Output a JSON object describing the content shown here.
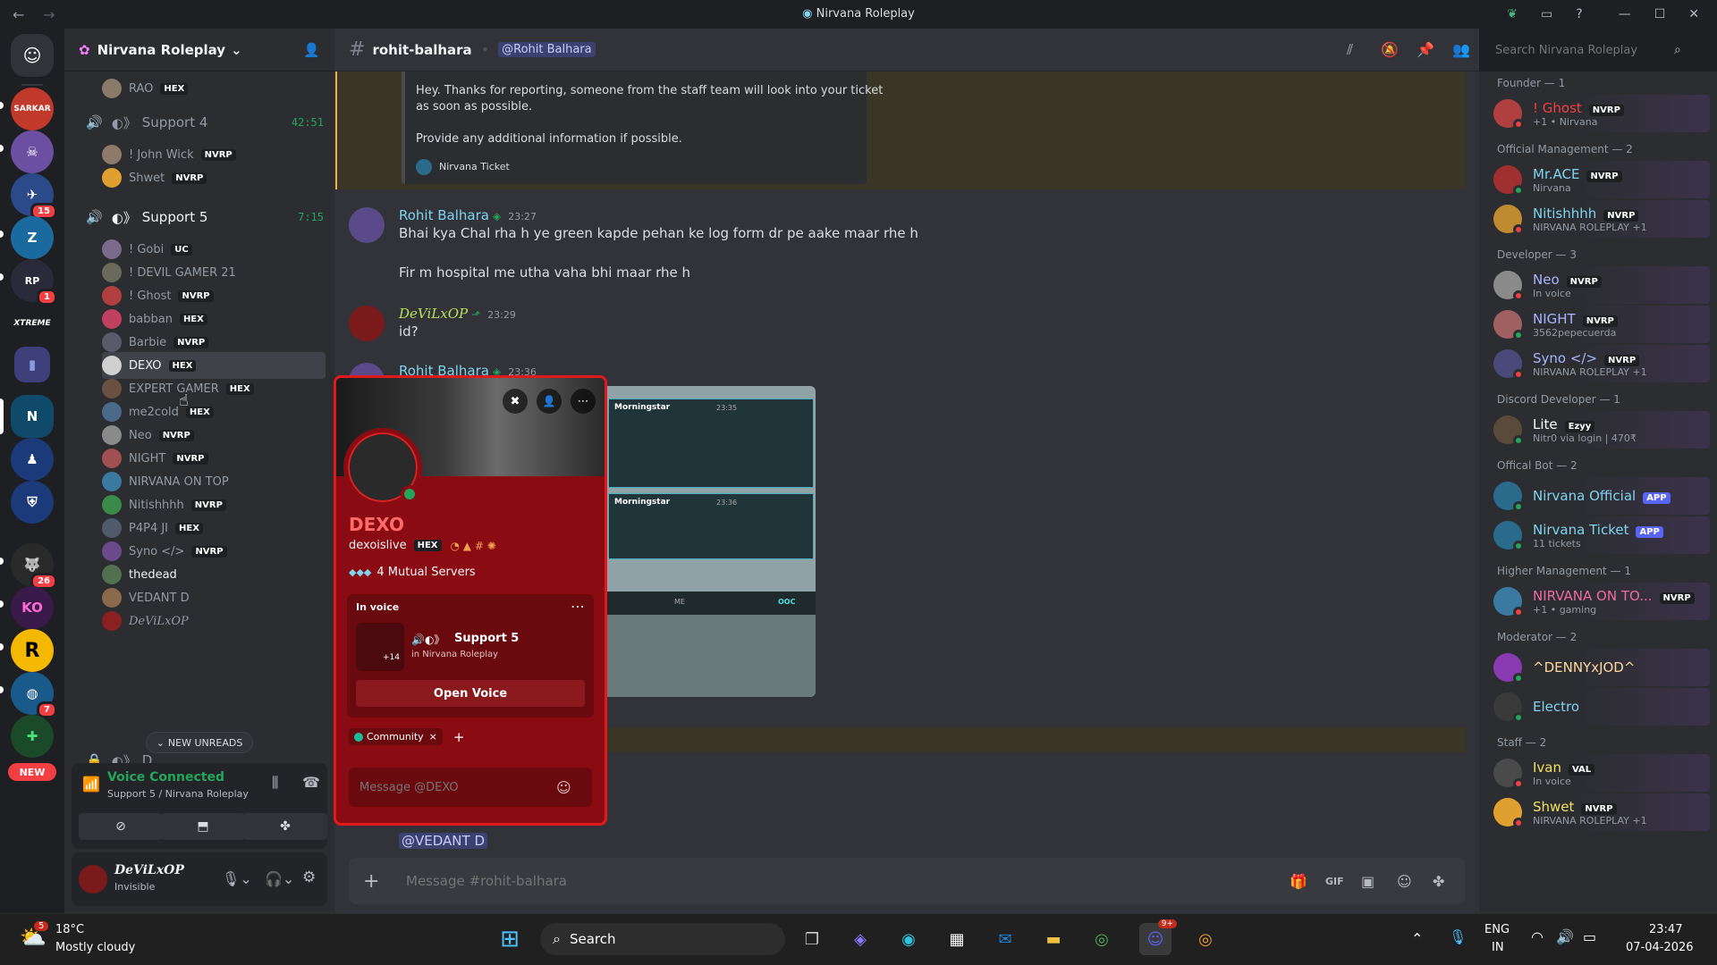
{
  "window": {
    "title": "Nirvana Roleplay"
  },
  "servers": {
    "badges": [
      "15",
      "1",
      "26",
      "7"
    ],
    "new_label": "NEW",
    "xtreme": "XTREME",
    "sarkar": "SARKAR"
  },
  "sidebar": {
    "server_name": "Nirvana Roleplay",
    "top_user": {
      "name": "RAO",
      "tag": "HEX"
    },
    "channels": [
      {
        "name": "Support 4",
        "time": "42:51",
        "users": [
          {
            "name": "! John Wick",
            "tag": "NVRP",
            "color": "#8e7a6a"
          },
          {
            "name": "Shwet",
            "tag": "NVRP",
            "color": "#e0a030"
          }
        ]
      },
      {
        "name": "Support 5",
        "time": "7:15",
        "users": [
          {
            "name": "! Gobi",
            "tag": "UC",
            "color": "#7a6b8a"
          },
          {
            "name": "! DEVIL GAMER 21",
            "tag": "",
            "color": "#6a6a5a"
          },
          {
            "name": "! Ghost",
            "tag": "NVRP",
            "color": "#b04040"
          },
          {
            "name": "babban",
            "tag": "HEX",
            "color": "#c04060"
          },
          {
            "name": "Barbie",
            "tag": "NVRP",
            "color": "#5a5a6a"
          },
          {
            "name": "DEXO",
            "tag": "HEX",
            "color": "#d0d0d0"
          },
          {
            "name": "EXPERT GAMER",
            "tag": "HEX",
            "color": "#6a5040"
          },
          {
            "name": "me2cold",
            "tag": "HEX",
            "color": "#4a6a8a"
          },
          {
            "name": "Neo",
            "tag": "NVRP",
            "color": "#8a8a8a"
          },
          {
            "name": "NIGHT",
            "tag": "NVRP",
            "color": "#a05050"
          },
          {
            "name": "NIRVANA ON TOP",
            "tag": "",
            "color": "#3a7aa0"
          },
          {
            "name": "Nitishhhh",
            "tag": "NVRP",
            "color": "#3a8a4a"
          },
          {
            "name": "P4P4 JI",
            "tag": "HEX",
            "color": "#505a6a"
          },
          {
            "name": "Syno </>",
            "tag": "NVRP",
            "color": "#6a4a8a"
          },
          {
            "name": "thedead",
            "tag": "",
            "color": "#507050"
          },
          {
            "name": "VEDANT D",
            "tag": "",
            "color": "#8a6a4a"
          },
          {
            "name": "DeViLxOP",
            "tag": "",
            "color": "#8a2020"
          }
        ]
      }
    ],
    "locked_channel": "D",
    "new_unreads": "NEW UNREADS",
    "voice": {
      "status": "Voice Connected",
      "location": "Support 5 / Nirvana Roleplay"
    },
    "user": {
      "name": "DeViLxOP",
      "status": "Invisible"
    }
  },
  "channel": {
    "name": "rohit-balhara",
    "mention": "@Rohit Balhara",
    "search_placeholder": "Search Nirvana Roleplay"
  },
  "messages": {
    "embed_line1": "Hey. Thanks for reporting, someone from the staff team will look into your ticket",
    "embed_line2": "as soon as possible.",
    "embed_line3": "Provide any additional information if possible.",
    "embed_footer": "Nirvana Ticket",
    "m1_author": "Rohit Balhara",
    "m1_time": "23:27",
    "m1_line1": "Bhai kya Chal rha h ye green kapde pehan ke log form dr pe aake maar rhe h",
    "m1_line2": "Fir m hospital me utha vaha bhi maar rhe h",
    "m2_author": "DeViLxOP",
    "m2_time": "23:29",
    "m2_text": "id?",
    "m3_author": "Rohit Balhara",
    "m3_time": "23:36",
    "img_label1": "Morningstar",
    "img_time1": "23:35",
    "img_label2": "Morningstar",
    "img_time2": "23:36",
    "img_me": "ME",
    "img_ooc": "OOC",
    "mention_vedant": "@VEDANT D",
    "input_placeholder": "Message #rohit-balhara"
  },
  "popup": {
    "display_name": "DEXO",
    "username": "dexoislive",
    "tag": "HEX",
    "mutual": "4 Mutual Servers",
    "in_voice": "In voice",
    "voice_channel": "Support 5",
    "voice_server": "in Nirvana Roleplay",
    "more_count": "+14",
    "open_voice": "Open Voice",
    "community": "Community",
    "message_placeholder": "Message @DEXO"
  },
  "members": {
    "groups": [
      {
        "label": "Founder — 1",
        "members": [
          {
            "name": "! Ghost",
            "tag": "NVRP",
            "sub": "+1 • Nirvana",
            "color": "#f23f43",
            "av": "#b04040",
            "status": "#f23f43"
          }
        ]
      },
      {
        "label": "Official Management — 2",
        "members": [
          {
            "name": "Mr.ACE",
            "tag": "NVRP",
            "sub": "Nirvana",
            "color": "#7fd4f0",
            "av": "#a03030",
            "status": "#23a55a"
          },
          {
            "name": "Nitishhhh",
            "tag": "NVRP",
            "sub": "NIRVANA ROLEPLAY +1",
            "color": "#7fd4f0",
            "av": "#c08a30",
            "status": "#f23f43"
          }
        ]
      },
      {
        "label": "Developer — 3",
        "members": [
          {
            "name": "Neo",
            "tag": "NVRP",
            "sub": "In voice",
            "color": "#a9b4ff",
            "av": "#8a8a8a",
            "status": "#f23f43"
          },
          {
            "name": "NIGHT",
            "tag": "NVRP",
            "sub": "3562pepecuerda",
            "color": "#a9b4ff",
            "av": "#a06060",
            "status": "#23a55a"
          },
          {
            "name": "Syno </>",
            "tag": "NVRP",
            "sub": "NIRVANA ROLEPLAY +1",
            "color": "#a9b4ff",
            "av": "#4a4a7a",
            "status": "#f23f43"
          }
        ]
      },
      {
        "label": "Discord Developer — 1",
        "members": [
          {
            "name": "Lite",
            "tag": "Ezyy",
            "sub": "Nitr0 via login | 470₹",
            "color": "#ffffff",
            "av": "#5a4a3a",
            "status": "#23a55a"
          }
        ]
      },
      {
        "label": "Offical Bot — 2",
        "members": [
          {
            "name": "Nirvana Official",
            "tag": "APP",
            "sub": "",
            "color": "#7fd4f0",
            "av": "#2a6a8a",
            "status": "#23a55a"
          },
          {
            "name": "Nirvana Ticket",
            "tag": "APP",
            "sub": "11 tickets",
            "color": "#7fd4f0",
            "av": "#2a6a8a",
            "status": "#23a55a"
          }
        ]
      },
      {
        "label": "Higher Management — 1",
        "members": [
          {
            "name": "NIRVANA ON TO...",
            "tag": "NVRP",
            "sub": "+1 • gaming",
            "color": "#f06aa0",
            "av": "#3a7aa0",
            "status": "#f23f43"
          }
        ]
      },
      {
        "label": "Moderator — 2",
        "members": [
          {
            "name": "^DENNYxJOD^",
            "tag": "",
            "sub": "",
            "color": "#ffd7a0",
            "av": "#8a3ab0",
            "status": "#23a55a"
          },
          {
            "name": "Electro",
            "tag": "",
            "sub": "",
            "color": "#7fd4f0",
            "av": "#3a3a3a",
            "status": "#23a55a"
          }
        ]
      },
      {
        "label": "Staff — 2",
        "members": [
          {
            "name": "Ivan",
            "tag": "VAL",
            "sub": "In voice",
            "color": "#f0e060",
            "av": "#4a4a4a",
            "status": "#f23f43"
          },
          {
            "name": "Shwet",
            "tag": "NVRP",
            "sub": "NIRVANA ROLEPLAY +1",
            "color": "#f0e060",
            "av": "#e0a030",
            "status": "#f23f43"
          }
        ]
      }
    ]
  },
  "taskbar": {
    "weather_temp": "18°C",
    "weather_desc": "Mostly cloudy",
    "weather_badge": "5",
    "search": "Search",
    "lang1": "ENG",
    "lang2": "IN",
    "time": "23:47",
    "date": "07-04-2026",
    "discord_badge": "9+"
  }
}
